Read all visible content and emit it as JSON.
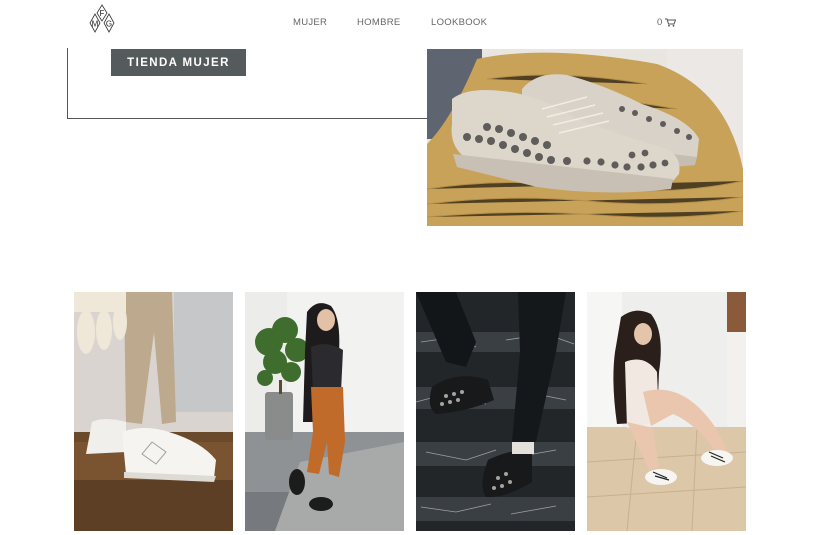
{
  "header": {
    "logo": {
      "letters": [
        "F",
        "M",
        "G"
      ]
    },
    "nav": [
      {
        "label": "MUJER",
        "icon": ""
      },
      {
        "label": "HOMBRE",
        "icon": ""
      },
      {
        "label": "LOOKBOOK",
        "icon": ""
      }
    ],
    "cart": {
      "count": "0",
      "icon": "cart-icon"
    }
  },
  "hero": {
    "cta_label": "TIENDA MUJER",
    "image": "studded-white-sneakers-on-knit-blanket"
  },
  "gallery": [
    {
      "image": "white-sneakers-with-tassels"
    },
    {
      "image": "woman-orange-pants-black-sneakers"
    },
    {
      "image": "studded-black-sneakers-on-stairs"
    },
    {
      "image": "woman-sitting-white-sneakers"
    }
  ],
  "colors": {
    "button": "#555a5c",
    "nav_text": "#666666"
  }
}
